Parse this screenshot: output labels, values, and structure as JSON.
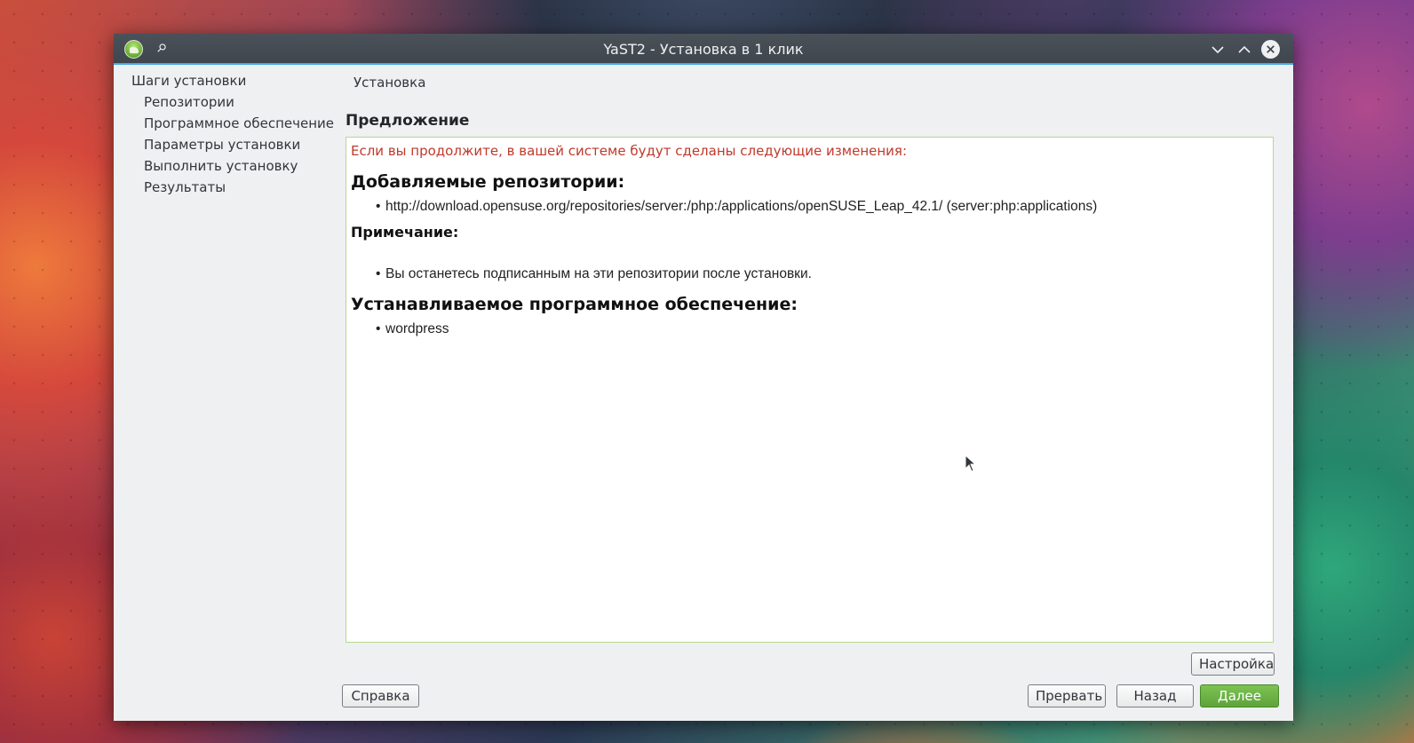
{
  "window": {
    "title": "YaST2 - Установка в 1 клик"
  },
  "steps": {
    "title": "Шаги установки",
    "items": [
      {
        "label": "Репозитории"
      },
      {
        "label": "Программное обеспечение"
      },
      {
        "label": "Параметры установки"
      },
      {
        "label": "Выполнить установку"
      },
      {
        "label": "Результаты"
      }
    ]
  },
  "breadcrumb": "Установка",
  "section_title": "Предложение",
  "content": {
    "intro": "Если вы продолжите, в вашей системе будут сделаны следующие изменения:",
    "repos_heading": "Добавляемые репозитории:",
    "repos": [
      "http://download.opensuse.org/repositories/server:/php:/applications/openSUSE_Leap_42.1/ (server:php:applications)"
    ],
    "note_heading": "Примечание:",
    "notes": [
      "Вы останетесь подписанным на эти репозитории после установки."
    ],
    "software_heading": "Устанавливаемое программное обеспечение:",
    "software": [
      "wordpress"
    ],
    "bullet": "•"
  },
  "buttons": {
    "setup": "Настройка",
    "help": "Справка",
    "abort": "Прервать",
    "back": "Назад",
    "next": "Далее"
  },
  "colors": {
    "accent": "#3daee9",
    "intro_text": "#c0392b",
    "next_button": "#5ea33a"
  },
  "icons": {
    "app": "yast-chameleon-icon",
    "pin": "pin-icon",
    "minimize": "chevron-down-icon",
    "maximize": "chevron-up-icon",
    "close": "close-icon"
  }
}
